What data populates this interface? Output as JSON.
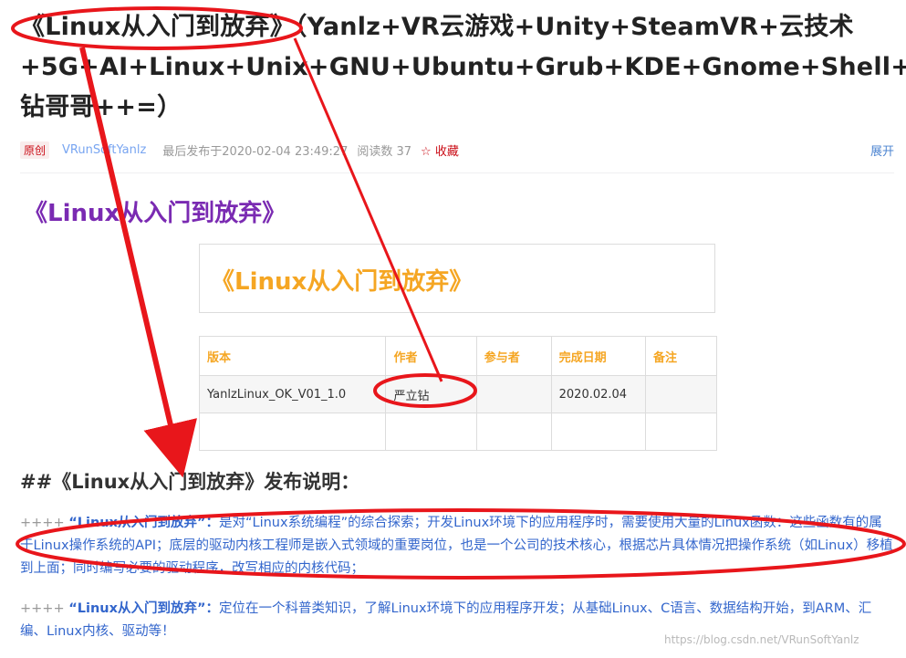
{
  "article": {
    "title": "《Linux从入门到放弃》（Yanlz+VR云游戏+Unity+SteamVR+云技术+5G+AI+Linux+Unix+GNU+Ubuntu+Grub+KDE+Gnome+Shell+立钻哥哥++=）",
    "meta": {
      "badge": "原创",
      "author": "VRunSoftYanlz",
      "published": "最后发布于2020-02-04 23:49:27",
      "reads": "阅读数 37",
      "collect": "☆ 收藏",
      "expand": "展开"
    },
    "heading_main": "《Linux从入门到放弃》",
    "card_title": "《Linux从入门到放弃》",
    "table": {
      "headers": [
        "版本",
        "作者",
        "参与者",
        "完成日期",
        "备注"
      ],
      "rows": [
        [
          "YanlzLinux_OK_V01_1.0",
          "严立钻",
          "",
          "2020.02.04",
          ""
        ],
        [
          "",
          "",
          "",
          "",
          ""
        ]
      ]
    },
    "section_heading": "##《Linux从入门到放弃》发布说明：",
    "paragraphs": [
      {
        "prefix": "++++",
        "emphasis": "“Linux从入门到放弃”：",
        "text": "是对“Linux系统编程”的综合探索；开发Linux环境下的应用程序时，需要使用大量的Linux函数：这些函数有的属于Linux操作系统的API；底层的驱动内核工程师是嵌入式领域的重要岗位，也是一个公司的技术核心，根据芯片具体情况把操作系统（如Linux）移植到上面；同时编写必要的驱动程序，改写相应的内核代码；"
      },
      {
        "prefix": "++++",
        "emphasis": "“Linux从入门到放弃”：",
        "text": "定位在一个科普类知识，了解Linux环境下的应用程序开发；从基础Linux、C语言、数据结构开始，到ARM、汇编、Linux内核、驱动等！"
      }
    ],
    "watermark": "https://blog.csdn.net/VRunSoftYanlz"
  },
  "colors": {
    "annotation_red": "#e8161b",
    "purple_heading": "#7a2ab2",
    "orange_title": "#f5a623",
    "link_blue": "#3366cc"
  }
}
